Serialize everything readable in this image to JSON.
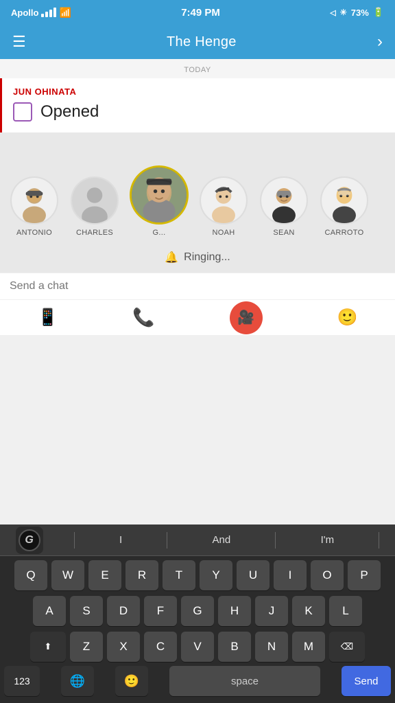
{
  "status_bar": {
    "carrier": "Apollo",
    "time": "7:49 PM",
    "battery": "73%"
  },
  "nav": {
    "title": "The Henge",
    "menu_label": "☰",
    "chevron": "›"
  },
  "today_label": "TODAY",
  "notification": {
    "user": "JUN OHINATA",
    "action": "Opened"
  },
  "stories": [
    {
      "name": "ANTONIO",
      "type": "avatar"
    },
    {
      "name": "CHARLES",
      "type": "placeholder"
    },
    {
      "name": "G...",
      "type": "avatar2"
    },
    {
      "name": "NOAH",
      "type": "avatar3"
    },
    {
      "name": "SEAN",
      "type": "avatar4"
    },
    {
      "name": "CARROTO",
      "type": "avatar5"
    }
  ],
  "ringing": "Ringing...",
  "chat_placeholder": "Send a chat",
  "suggestions": [
    "I",
    "And",
    "I'm"
  ],
  "keyboard_rows": [
    [
      "Q",
      "W",
      "E",
      "R",
      "T",
      "Y",
      "U",
      "I",
      "O",
      "P"
    ],
    [
      "A",
      "S",
      "D",
      "F",
      "G",
      "H",
      "J",
      "K",
      "L"
    ],
    [
      "Z",
      "X",
      "C",
      "V",
      "B",
      "N",
      "M"
    ]
  ],
  "bottom_keys": {
    "num": "123",
    "space": "space",
    "send": "Send"
  }
}
